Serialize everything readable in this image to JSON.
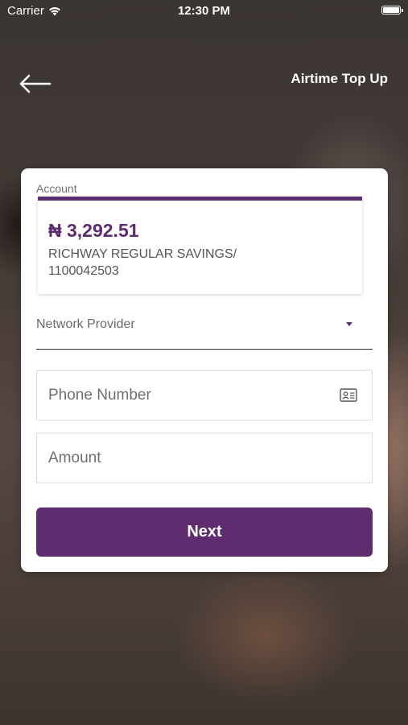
{
  "status_bar": {
    "carrier": "Carrier",
    "time": "12:30 PM"
  },
  "header": {
    "title": "Airtime Top Up",
    "back_icon": "back-arrow-icon"
  },
  "account": {
    "label": "Account",
    "balance": "₦ 3,292.51",
    "name": "RICHWAY REGULAR SAVINGS/ 1100042503"
  },
  "network": {
    "placeholder": "Network Provider"
  },
  "phone": {
    "placeholder": "Phone Number",
    "value": "",
    "icon": "contact-card-icon"
  },
  "amount": {
    "placeholder": "Amount",
    "value": ""
  },
  "next_button": {
    "label": "Next"
  },
  "colors": {
    "brand": "#5e2c6f",
    "card": "#ffffff",
    "text_muted": "#6f6f6f"
  }
}
